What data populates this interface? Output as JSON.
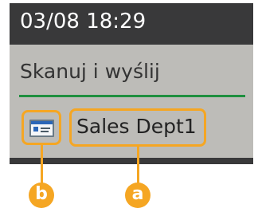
{
  "status": {
    "time": "03/08 18:29"
  },
  "screen": {
    "function_title": "Skanuj i wyślij",
    "destination": {
      "icon": "address-book-icon",
      "name": "Sales Dept1"
    }
  },
  "callouts": {
    "a": "a",
    "b": "b"
  },
  "colors": {
    "lcd_background": "#bdbcb8",
    "status_bar": "#39393a",
    "divider": "#1f8f3f",
    "highlight": "#f5a623"
  }
}
